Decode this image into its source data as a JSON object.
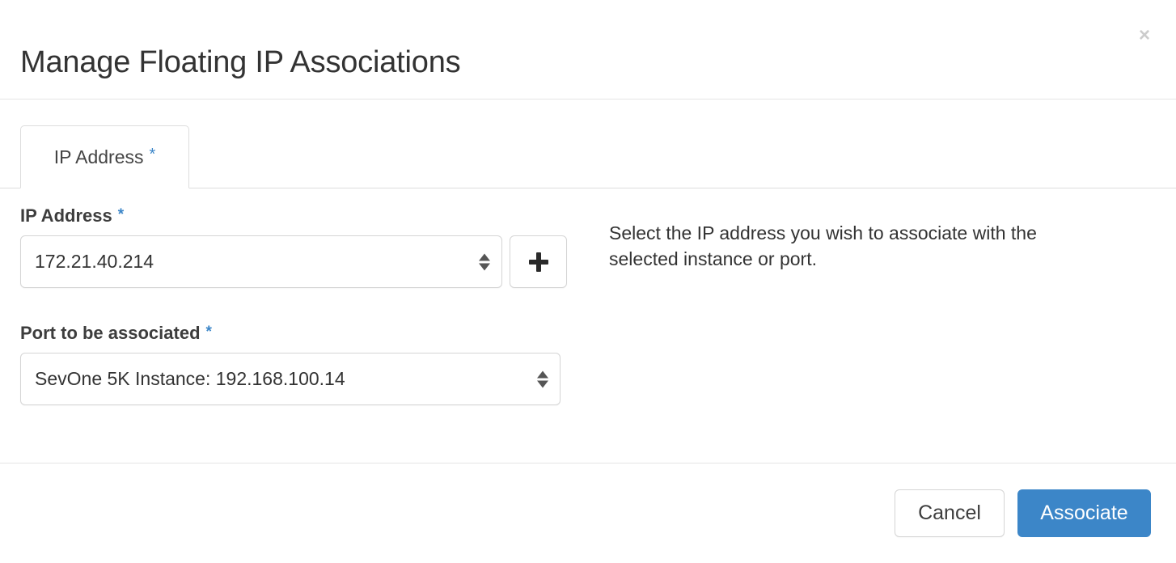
{
  "dialog": {
    "title": "Manage Floating IP Associations",
    "close_label": "×",
    "close_icon": "close-icon"
  },
  "tabs": [
    {
      "label": "IP Address",
      "required_marker": "*",
      "active": true
    }
  ],
  "form": {
    "fields": [
      {
        "label": "IP Address",
        "required_marker": "*",
        "type": "select",
        "value": "172.21.40.214",
        "add_button_label": "+",
        "add_button_icon": "plus-icon"
      },
      {
        "label": "Port to be associated",
        "required_marker": "*",
        "type": "select",
        "value": "SevOne 5K Instance: 192.168.100.14"
      }
    ]
  },
  "help": {
    "text": "Select the IP address you wish to associate with the selected instance or port."
  },
  "footer": {
    "cancel_label": "Cancel",
    "submit_label": "Associate"
  },
  "colors": {
    "accent": "#3c86c8",
    "text": "#333333",
    "border": "#dddddd",
    "close_icon": "#cccccc"
  }
}
